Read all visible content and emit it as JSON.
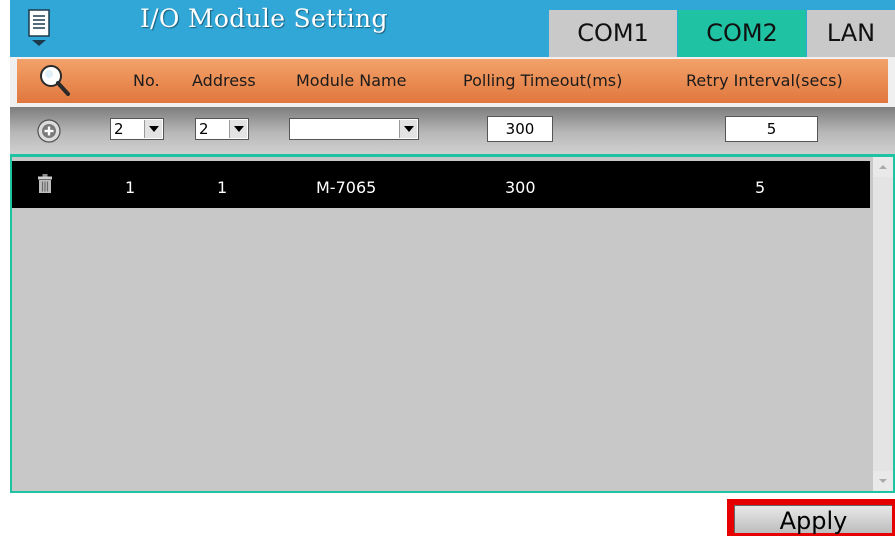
{
  "header": {
    "title": "I/O Module Setting",
    "tabs": [
      {
        "label": "COM1"
      },
      {
        "label": "COM2",
        "active": true
      },
      {
        "label": "LAN"
      }
    ]
  },
  "columns": {
    "no": "No.",
    "address": "Address",
    "module_name": "Module Name",
    "polling_timeout": "Polling Timeout(ms)",
    "retry_interval": "Retry Interval(secs)"
  },
  "entry": {
    "no_value": "2",
    "address_value": "2",
    "module_name_value": "",
    "polling_timeout_value": "300",
    "retry_interval_value": "5"
  },
  "rows": [
    {
      "no": "1",
      "address": "1",
      "module_name": "M-7065",
      "polling_timeout": "300",
      "retry_interval": "5"
    }
  ],
  "apply_label": "Apply",
  "colors": {
    "header_bg": "#31a7d7",
    "active_tab": "#1fc3a3",
    "inactive_tab": "#c9c9c9",
    "column_header": "#e8864b",
    "apply_highlight": "#e60000"
  },
  "icons": {
    "menu": "menu-icon",
    "search": "search-icon",
    "add": "plus-circle-icon",
    "delete": "trash-icon"
  }
}
